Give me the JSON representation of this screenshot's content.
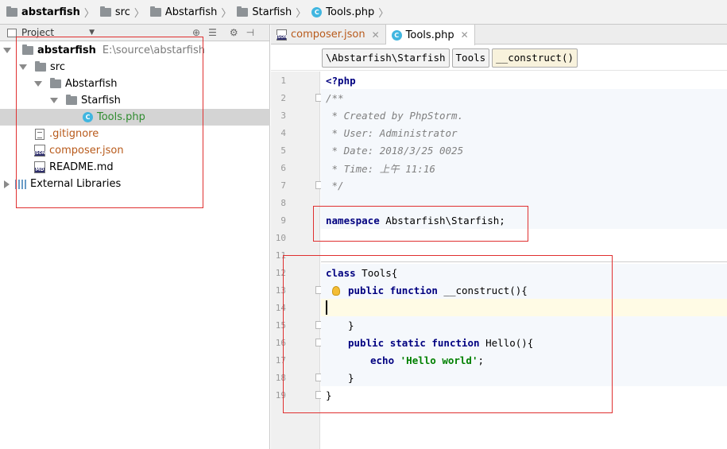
{
  "navbar": {
    "crumbs": [
      "abstarfish",
      "src",
      "Abstarfish",
      "Starfish",
      "Tools.php"
    ]
  },
  "project_panel": {
    "title": "Project",
    "tree": [
      {
        "label": "abstarfish",
        "path": "E:\\source\\abstarfish"
      },
      {
        "label": "src"
      },
      {
        "label": "Abstarfish"
      },
      {
        "label": "Starfish"
      },
      {
        "label": "Tools.php"
      },
      {
        "label": ".gitignore"
      },
      {
        "label": "composer.json"
      },
      {
        "label": "README.md"
      },
      {
        "label": "External Libraries"
      }
    ],
    "json_icon_text": "JSON",
    "md_icon_text": "MD"
  },
  "tabs": [
    {
      "label": "composer.json",
      "active": false
    },
    {
      "label": "Tools.php",
      "active": true
    }
  ],
  "editor_breadcrumb": [
    "\\Abstarfish\\Starfish",
    "Tools",
    "__construct()"
  ],
  "line_numbers": [
    "1",
    "2",
    "3",
    "4",
    "5",
    "6",
    "7",
    "8",
    "9",
    "10",
    "11",
    "12",
    "13",
    "14",
    "15",
    "16",
    "17",
    "18",
    "19"
  ],
  "code": {
    "l1": "<?php",
    "l2": "/**",
    "l3": " * Created by PhpStorm.",
    "l4": " * User: Administrator",
    "l5": " * Date: 2018/3/25 0025",
    "l6": " * Time: 上午 11:16",
    "l7": " */",
    "l9_kw": "namespace",
    "l9_rest": " Abstarfish\\Starfish;",
    "l12_kw": "class",
    "l12_rest": " Tools{",
    "l13_kw1": "public",
    "l13_kw2": "function",
    "l13_rest": " __construct(){",
    "l15": "}",
    "l16_kw1": "public",
    "l16_kw2": "static",
    "l16_kw3": "function",
    "l16_rest": " Hello(){",
    "l17_kw": "echo",
    "l17_str": "'Hello world'",
    "l17_end": ";",
    "l18": "}",
    "l19": "}"
  },
  "colors": {
    "keyword": "#000080",
    "comment": "#808080",
    "string": "#008000",
    "annotation_box": "#e03030",
    "current_line": "#fffbe5"
  }
}
